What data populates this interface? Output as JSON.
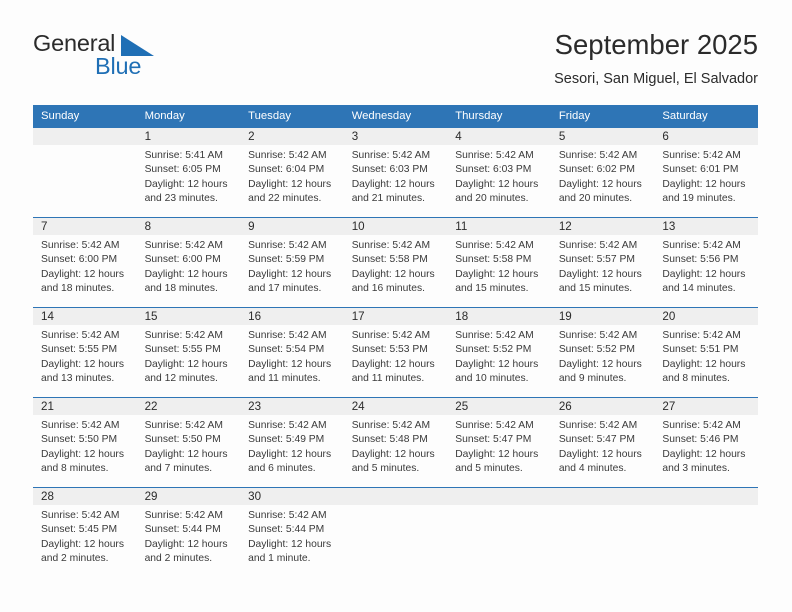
{
  "logo": {
    "word1": "General",
    "word2": "Blue",
    "triangle_color": "#1f6fb5",
    "text_color": "#2b2b2b"
  },
  "header": {
    "title": "September 2025",
    "subtitle": "Sesori, San Miguel, El Salvador"
  },
  "theme": {
    "header_bg": "#2e75b6",
    "header_text": "#ffffff",
    "daynum_band": "#efefef",
    "rule": "#2e75b6"
  },
  "calendar": {
    "weekday_headers": [
      "Sunday",
      "Monday",
      "Tuesday",
      "Wednesday",
      "Thursday",
      "Friday",
      "Saturday"
    ],
    "weeks": [
      [
        {
          "day": "",
          "lines": []
        },
        {
          "day": "1",
          "lines": [
            "Sunrise: 5:41 AM",
            "Sunset: 6:05 PM",
            "Daylight: 12 hours",
            "and 23 minutes."
          ]
        },
        {
          "day": "2",
          "lines": [
            "Sunrise: 5:42 AM",
            "Sunset: 6:04 PM",
            "Daylight: 12 hours",
            "and 22 minutes."
          ]
        },
        {
          "day": "3",
          "lines": [
            "Sunrise: 5:42 AM",
            "Sunset: 6:03 PM",
            "Daylight: 12 hours",
            "and 21 minutes."
          ]
        },
        {
          "day": "4",
          "lines": [
            "Sunrise: 5:42 AM",
            "Sunset: 6:03 PM",
            "Daylight: 12 hours",
            "and 20 minutes."
          ]
        },
        {
          "day": "5",
          "lines": [
            "Sunrise: 5:42 AM",
            "Sunset: 6:02 PM",
            "Daylight: 12 hours",
            "and 20 minutes."
          ]
        },
        {
          "day": "6",
          "lines": [
            "Sunrise: 5:42 AM",
            "Sunset: 6:01 PM",
            "Daylight: 12 hours",
            "and 19 minutes."
          ]
        }
      ],
      [
        {
          "day": "7",
          "lines": [
            "Sunrise: 5:42 AM",
            "Sunset: 6:00 PM",
            "Daylight: 12 hours",
            "and 18 minutes."
          ]
        },
        {
          "day": "8",
          "lines": [
            "Sunrise: 5:42 AM",
            "Sunset: 6:00 PM",
            "Daylight: 12 hours",
            "and 18 minutes."
          ]
        },
        {
          "day": "9",
          "lines": [
            "Sunrise: 5:42 AM",
            "Sunset: 5:59 PM",
            "Daylight: 12 hours",
            "and 17 minutes."
          ]
        },
        {
          "day": "10",
          "lines": [
            "Sunrise: 5:42 AM",
            "Sunset: 5:58 PM",
            "Daylight: 12 hours",
            "and 16 minutes."
          ]
        },
        {
          "day": "11",
          "lines": [
            "Sunrise: 5:42 AM",
            "Sunset: 5:58 PM",
            "Daylight: 12 hours",
            "and 15 minutes."
          ]
        },
        {
          "day": "12",
          "lines": [
            "Sunrise: 5:42 AM",
            "Sunset: 5:57 PM",
            "Daylight: 12 hours",
            "and 15 minutes."
          ]
        },
        {
          "day": "13",
          "lines": [
            "Sunrise: 5:42 AM",
            "Sunset: 5:56 PM",
            "Daylight: 12 hours",
            "and 14 minutes."
          ]
        }
      ],
      [
        {
          "day": "14",
          "lines": [
            "Sunrise: 5:42 AM",
            "Sunset: 5:55 PM",
            "Daylight: 12 hours",
            "and 13 minutes."
          ]
        },
        {
          "day": "15",
          "lines": [
            "Sunrise: 5:42 AM",
            "Sunset: 5:55 PM",
            "Daylight: 12 hours",
            "and 12 minutes."
          ]
        },
        {
          "day": "16",
          "lines": [
            "Sunrise: 5:42 AM",
            "Sunset: 5:54 PM",
            "Daylight: 12 hours",
            "and 11 minutes."
          ]
        },
        {
          "day": "17",
          "lines": [
            "Sunrise: 5:42 AM",
            "Sunset: 5:53 PM",
            "Daylight: 12 hours",
            "and 11 minutes."
          ]
        },
        {
          "day": "18",
          "lines": [
            "Sunrise: 5:42 AM",
            "Sunset: 5:52 PM",
            "Daylight: 12 hours",
            "and 10 minutes."
          ]
        },
        {
          "day": "19",
          "lines": [
            "Sunrise: 5:42 AM",
            "Sunset: 5:52 PM",
            "Daylight: 12 hours",
            "and 9 minutes."
          ]
        },
        {
          "day": "20",
          "lines": [
            "Sunrise: 5:42 AM",
            "Sunset: 5:51 PM",
            "Daylight: 12 hours",
            "and 8 minutes."
          ]
        }
      ],
      [
        {
          "day": "21",
          "lines": [
            "Sunrise: 5:42 AM",
            "Sunset: 5:50 PM",
            "Daylight: 12 hours",
            "and 8 minutes."
          ]
        },
        {
          "day": "22",
          "lines": [
            "Sunrise: 5:42 AM",
            "Sunset: 5:50 PM",
            "Daylight: 12 hours",
            "and 7 minutes."
          ]
        },
        {
          "day": "23",
          "lines": [
            "Sunrise: 5:42 AM",
            "Sunset: 5:49 PM",
            "Daylight: 12 hours",
            "and 6 minutes."
          ]
        },
        {
          "day": "24",
          "lines": [
            "Sunrise: 5:42 AM",
            "Sunset: 5:48 PM",
            "Daylight: 12 hours",
            "and 5 minutes."
          ]
        },
        {
          "day": "25",
          "lines": [
            "Sunrise: 5:42 AM",
            "Sunset: 5:47 PM",
            "Daylight: 12 hours",
            "and 5 minutes."
          ]
        },
        {
          "day": "26",
          "lines": [
            "Sunrise: 5:42 AM",
            "Sunset: 5:47 PM",
            "Daylight: 12 hours",
            "and 4 minutes."
          ]
        },
        {
          "day": "27",
          "lines": [
            "Sunrise: 5:42 AM",
            "Sunset: 5:46 PM",
            "Daylight: 12 hours",
            "and 3 minutes."
          ]
        }
      ],
      [
        {
          "day": "28",
          "lines": [
            "Sunrise: 5:42 AM",
            "Sunset: 5:45 PM",
            "Daylight: 12 hours",
            "and 2 minutes."
          ]
        },
        {
          "day": "29",
          "lines": [
            "Sunrise: 5:42 AM",
            "Sunset: 5:44 PM",
            "Daylight: 12 hours",
            "and 2 minutes."
          ]
        },
        {
          "day": "30",
          "lines": [
            "Sunrise: 5:42 AM",
            "Sunset: 5:44 PM",
            "Daylight: 12 hours",
            "and 1 minute."
          ]
        },
        {
          "day": "",
          "lines": []
        },
        {
          "day": "",
          "lines": []
        },
        {
          "day": "",
          "lines": []
        },
        {
          "day": "",
          "lines": []
        }
      ]
    ]
  }
}
